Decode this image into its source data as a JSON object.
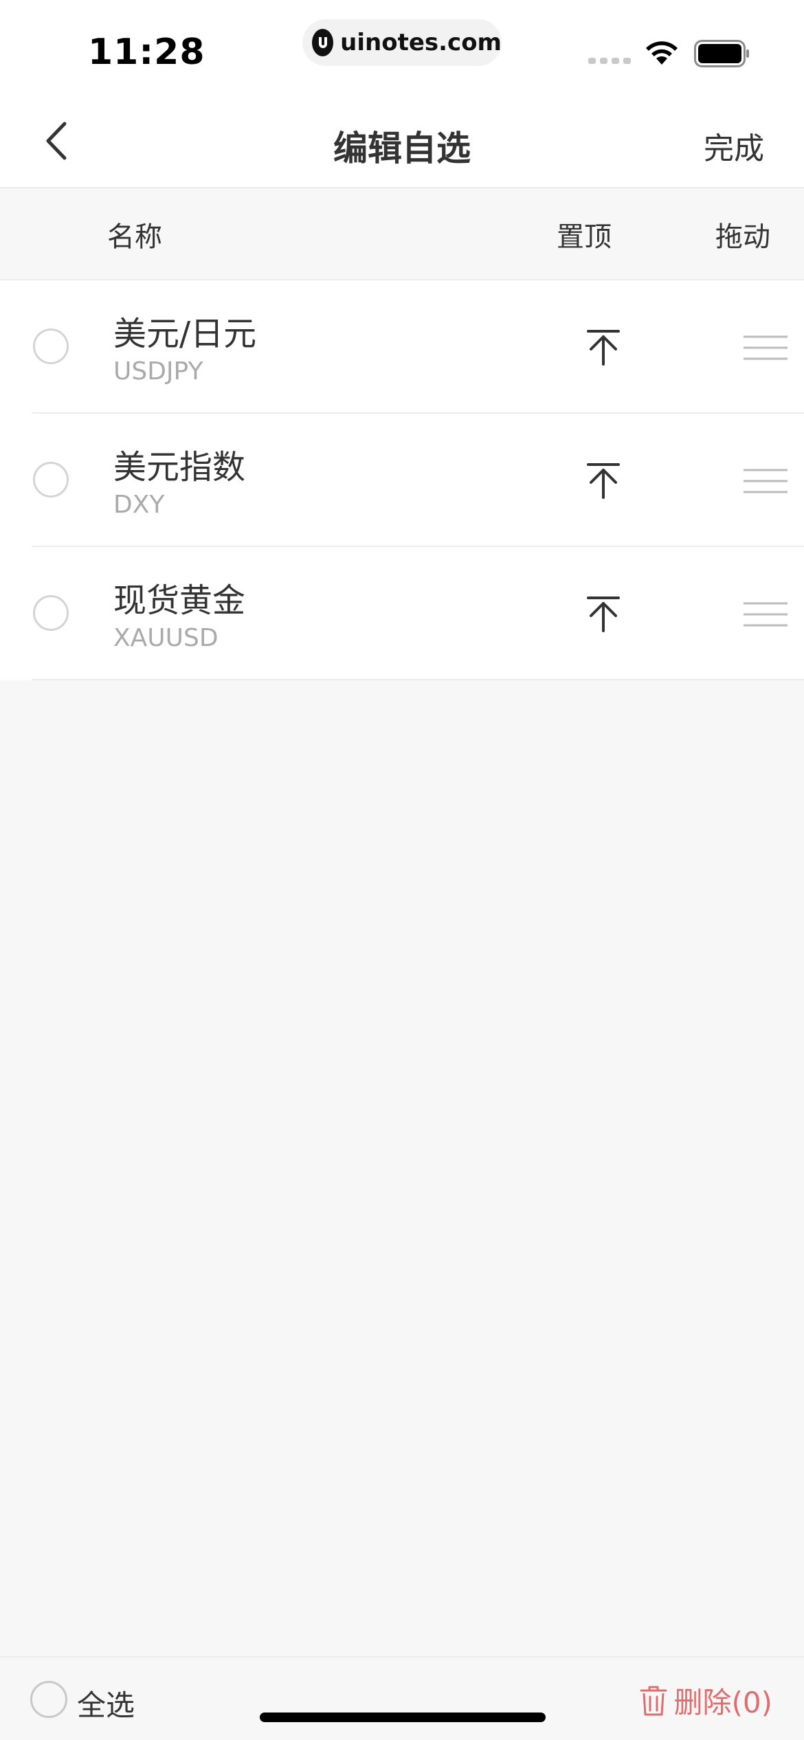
{
  "status_bar": {
    "time": "11:28",
    "url": "uinotes.com"
  },
  "nav": {
    "title": "编辑自选",
    "done_label": "完成"
  },
  "columns": {
    "name": "名称",
    "pin": "置顶",
    "drag": "拖动"
  },
  "items": [
    {
      "name": "美元/日元",
      "code": "USDJPY"
    },
    {
      "name": "美元指数",
      "code": "DXY"
    },
    {
      "name": "现货黄金",
      "code": "XAUUSD"
    }
  ],
  "footer": {
    "select_all_label": "全选",
    "delete_label": "删除(0)"
  },
  "colors": {
    "accent_delete": "#e06d6d",
    "text_primary": "#333333",
    "text_secondary": "#aaaaaa",
    "background": "#f7f7f7"
  },
  "icons": {
    "back": "chevron-left-icon",
    "pin": "pin-to-top-icon",
    "drag": "drag-handle-icon",
    "delete": "trash-icon",
    "wifi": "wifi-icon",
    "battery": "battery-icon"
  }
}
